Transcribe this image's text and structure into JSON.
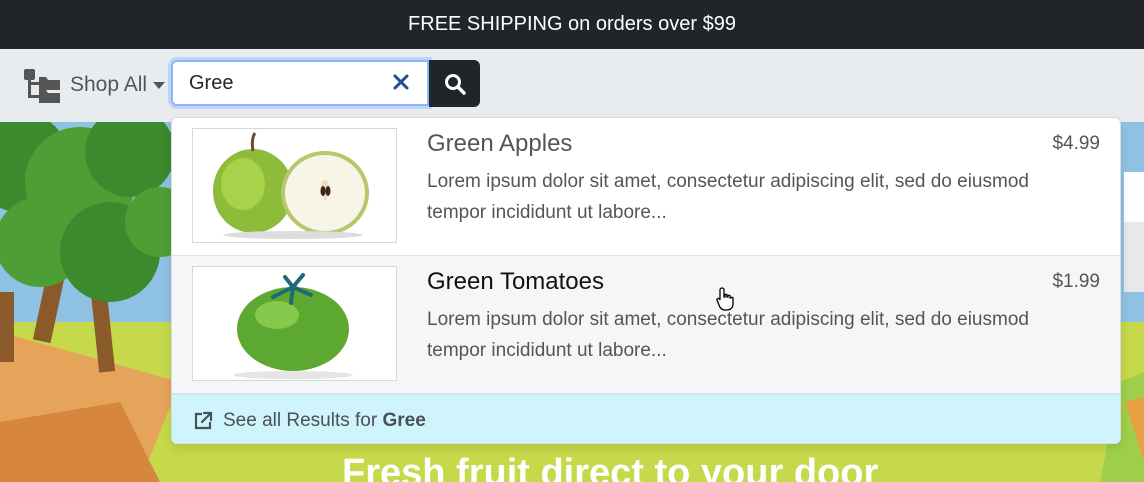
{
  "banner": {
    "text": "FREE SHIPPING on orders over $99"
  },
  "nav": {
    "shop_all_label": "Shop All",
    "brand_icon": "category-tree-icon"
  },
  "search": {
    "value": "Gree",
    "clear_icon": "close-icon",
    "button_icon": "search-icon"
  },
  "hero": {
    "title": "Fresh fruit direct to your door"
  },
  "results": [
    {
      "name": "Green Apples",
      "price": "$4.99",
      "description": "Lorem ipsum dolor sit amet, consectetur adipiscing elit, sed do eiusmod tempor incididunt ut labore..."
    },
    {
      "name": "Green Tomatoes",
      "price": "$1.99",
      "description": "Lorem ipsum dolor sit amet, consectetur adipiscing elit, sed do eiusmod tempor incididunt ut labore..."
    }
  ],
  "see_all": {
    "prefix": "See all Results for ",
    "query": "Gree",
    "icon": "external-link-icon"
  },
  "colors": {
    "topbar": "#212529",
    "navbar": "#e9ecef",
    "focus": "#86b7fe",
    "footer": "#cff4fc"
  }
}
